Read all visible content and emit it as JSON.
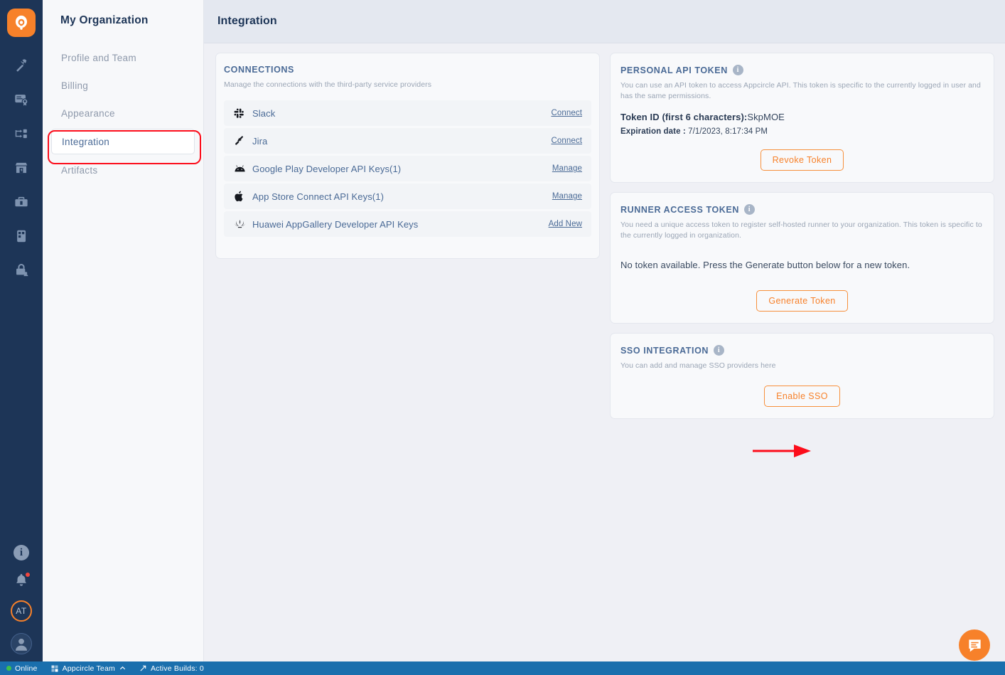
{
  "app": {
    "logo_icon": "appcircle-logo-icon",
    "chat_icon": "chat-bubble-icon"
  },
  "rail": {
    "items": [
      {
        "icon": "hammer-build-icon",
        "name": "build"
      },
      {
        "icon": "certificate-signing-icon",
        "name": "signing-identity"
      },
      {
        "icon": "distribution-flow-icon",
        "name": "distribution"
      },
      {
        "icon": "store-submit-icon",
        "name": "store-submit"
      },
      {
        "icon": "toolbox-icon",
        "name": "toolbox"
      },
      {
        "icon": "testing-distribution-icon",
        "name": "testing-distribution"
      },
      {
        "icon": "lock-user-icon",
        "name": "enterprise-app-store"
      }
    ],
    "bottom": {
      "info_icon": "info-icon",
      "notifications_icon": "bell-icon",
      "user_initials": "AT",
      "profile_icon": "person-avatar-icon"
    }
  },
  "sidebar": {
    "title": "My Organization",
    "items": [
      {
        "label": "Profile and Team",
        "active": false
      },
      {
        "label": "Billing",
        "active": false
      },
      {
        "label": "Appearance",
        "active": false
      },
      {
        "label": "Integration",
        "active": true
      },
      {
        "label": "Artifacts",
        "active": false
      }
    ]
  },
  "header": {
    "title": "Integration"
  },
  "connections": {
    "title": "CONNECTIONS",
    "subtitle": "Manage the connections with the third-party service providers",
    "rows": [
      {
        "icon": "slack-icon",
        "name": "Slack",
        "action": "Connect"
      },
      {
        "icon": "jira-icon",
        "name": "Jira",
        "action": "Connect"
      },
      {
        "icon": "android-icon",
        "name": "Google Play Developer API Keys(1)",
        "action": "Manage"
      },
      {
        "icon": "apple-icon",
        "name": "App Store Connect API Keys(1)",
        "action": "Manage"
      },
      {
        "icon": "huawei-icon",
        "name": "Huawei AppGallery Developer API Keys",
        "action": "Add New"
      }
    ]
  },
  "personal_api_token": {
    "title": "PERSONAL API TOKEN",
    "info_icon": "info-icon",
    "description": "You can use an API token to access Appcircle API. This token is specific to the currently logged in user and has the same permissions.",
    "token_id_label": "Token ID (first 6 characters):",
    "token_id_value": "SkpMOE",
    "expiration_label": "Expiration date :",
    "expiration_value": "7/1/2023, 8:17:34 PM",
    "button": "Revoke Token"
  },
  "runner_access_token": {
    "title": "RUNNER ACCESS TOKEN",
    "info_icon": "info-icon",
    "description": "You need a unique access token to register self-hosted runner to your organization. This token is specific to the currently logged in organization.",
    "empty_message": "No token available. Press the Generate button below for a new token.",
    "button": "Generate Token"
  },
  "sso_integration": {
    "title": "SSO INTEGRATION",
    "info_icon": "info-icon",
    "description": "You can add and manage SSO providers here",
    "button": "Enable SSO"
  },
  "statusbar": {
    "connection": "Online",
    "team": "Appcircle Team",
    "team_chevron_icon": "chevron-up-icon",
    "builds_icon": "build-arrow-icon",
    "builds": "Active Builds: 0"
  },
  "colors": {
    "accent_orange": "#f7812a",
    "rail_navy": "#1d3557",
    "status_blue": "#1a6fad",
    "annotation_red": "#fc0d1b",
    "online_green": "#3fc04a",
    "link_blue": "#4a6a96"
  }
}
